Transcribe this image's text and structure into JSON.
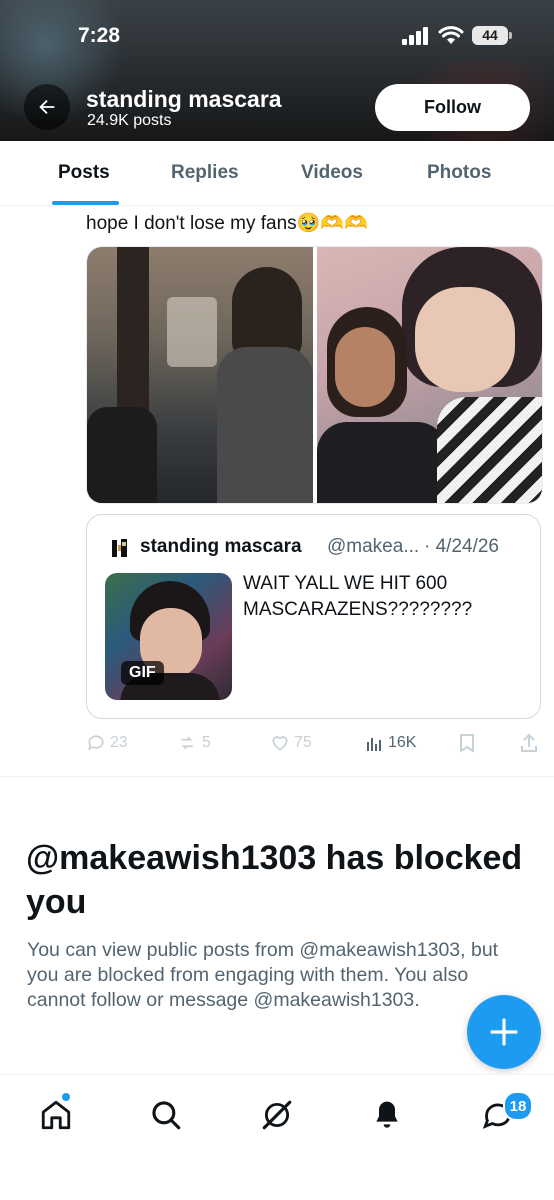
{
  "status_bar": {
    "time": "7:28",
    "battery": "44"
  },
  "header": {
    "name": "standing mascara",
    "post_count": "24.9K posts",
    "follow_label": "Follow"
  },
  "tabs": [
    {
      "label": "Posts",
      "active": true
    },
    {
      "label": "Replies",
      "active": false
    },
    {
      "label": "Videos",
      "active": false
    },
    {
      "label": "Photos",
      "active": false
    }
  ],
  "post": {
    "text": "hope I don't lose my fans🥹🫶🫶",
    "quote": {
      "name": "standing mascara",
      "handle": "@makea...",
      "date": "· 4/24/26",
      "gif_label": "GIF",
      "text": "WAIT YALL WE HIT 600 MASCARAZENS????????"
    },
    "actions": {
      "replies": "23",
      "reposts": "5",
      "likes": "75",
      "views": "16K"
    }
  },
  "blocked": {
    "title": "@makeawish1303 has blocked you",
    "description": "You can view public posts from @makeawish1303, but you are blocked from engaging with them. You also cannot follow or message @makeawish1303."
  },
  "bottom_nav": {
    "messages_badge": "18"
  },
  "colors": {
    "accent": "#1d9bf0",
    "text": "#0f1419",
    "secondary": "#536471"
  }
}
